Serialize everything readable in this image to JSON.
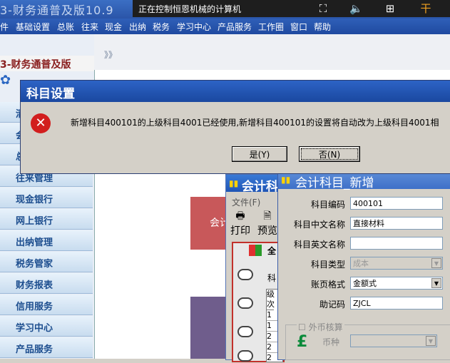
{
  "app": {
    "title": "3-财务通普及版10.9",
    "sidebar_title": "3-财务通普及版"
  },
  "remote": {
    "status": "正在控制恒恩机械的计算机"
  },
  "menubar": [
    "件",
    "基础设置",
    "总账",
    "往来",
    "现金",
    "出纳",
    "税务",
    "学习中心",
    "产品服务",
    "工作圈",
    "窗口",
    "帮助"
  ],
  "sidebar": {
    "chevron": "》》",
    "items": [
      "清",
      "会",
      "总",
      "往来管理",
      "现金银行",
      "网上银行",
      "出纳管理",
      "税务管家",
      "财务报表",
      "信用服务",
      "学习中心",
      "产品服务"
    ]
  },
  "content": {
    "red_tile_text": "会计"
  },
  "account_window": {
    "title": "会计科",
    "menu_file": "文件(F)",
    "print_label": "打印",
    "preview_label": "预览",
    "tree_root": "全",
    "header_ke": "科",
    "col_level": "级次",
    "levels": [
      "1",
      "1",
      "2",
      "2",
      "2"
    ]
  },
  "new_account_dialog": {
    "title": "会计科目_新增",
    "fields": {
      "code_label": "科目编码",
      "code_value": "400101",
      "cn_name_label": "科目中文名称",
      "cn_name_value": "直接材料",
      "en_name_label": "科目英文名称",
      "en_name_value": "",
      "type_label": "科目类型",
      "type_value": "成本",
      "format_label": "账页格式",
      "format_value": "金额式",
      "mnemonic_label": "助记码",
      "mnemonic_value": "ZJCL"
    },
    "foreign_currency_label": "外币核算",
    "currency_label": "币种"
  },
  "message_box": {
    "title": "科目设置",
    "text": "新增科目400101的上级科目4001已经使用,新增科目400101的设置将自动改为上级科目4001相",
    "yes_label": "是(Y)",
    "no_label": "否(N)"
  }
}
